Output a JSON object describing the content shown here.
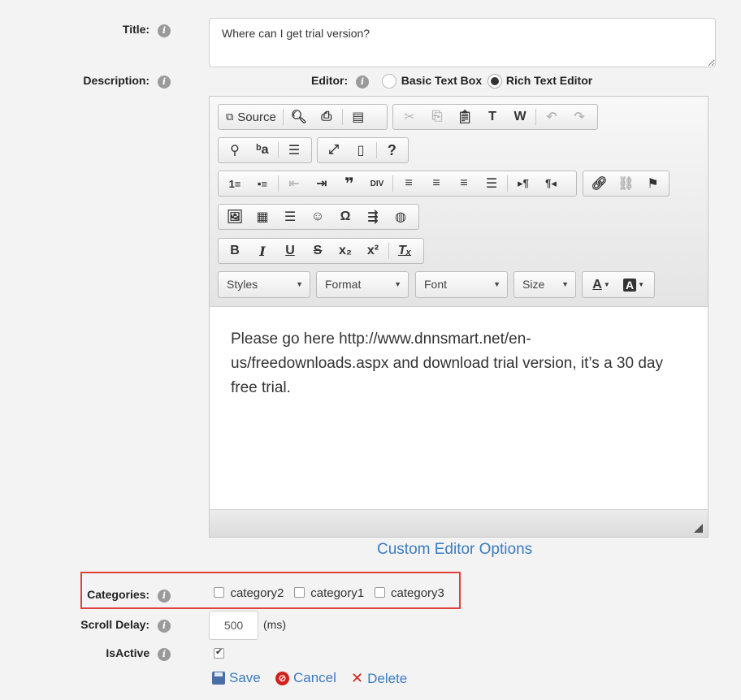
{
  "form": {
    "title_label": "Title:",
    "title_value": "Where can I get trial version?",
    "description_label": "Description:",
    "editor_label": "Editor:",
    "editor_options": [
      {
        "label": "Basic Text Box",
        "checked": false
      },
      {
        "label": "Rich Text Editor",
        "checked": true
      }
    ],
    "categories_label": "Categories:",
    "categories": [
      {
        "label": "category2",
        "checked": false
      },
      {
        "label": "category1",
        "checked": false
      },
      {
        "label": "category3",
        "checked": false
      }
    ],
    "scroll_delay_label": "Scroll Delay:",
    "scroll_delay_value": "500",
    "scroll_delay_unit": "(ms)",
    "isactive_label": "IsActive",
    "isactive_checked": true
  },
  "editor": {
    "source_label": "Source",
    "combos": {
      "styles": "Styles",
      "format": "Format",
      "font": "Font",
      "size": "Size"
    },
    "content": "Please go here http://www.dnnsmart.net/en-us/freedownloads.aspx and download trial version, it’s a 30 day free trial."
  },
  "custom_editor_link": "Custom Editor Options",
  "actions": {
    "save": "Save",
    "cancel": "Cancel",
    "delete": "Delete"
  },
  "colors": {
    "link": "#3c7bc1",
    "highlight": "#e0413c",
    "cancel_icon": "#d0211c",
    "delete_icon": "#d0211c"
  }
}
